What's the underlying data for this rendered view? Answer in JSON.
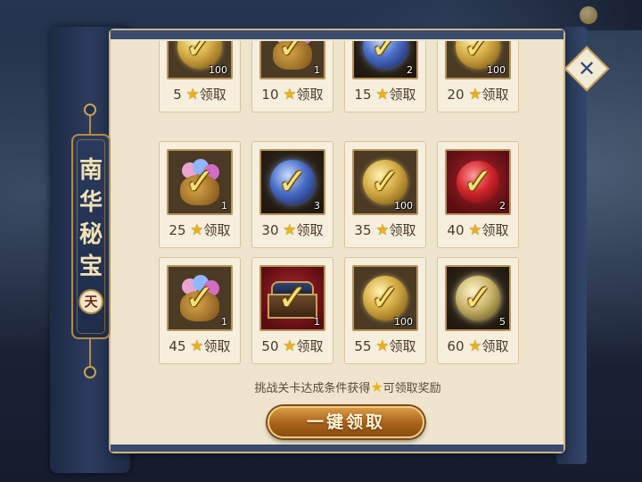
{
  "banner": {
    "title_chars": [
      "南",
      "华",
      "秘",
      "宝"
    ],
    "tier_badge": "天"
  },
  "rewards": [
    {
      "threshold": "5",
      "claim_label": "领取",
      "item": "gold-coin-icon",
      "qty": "100"
    },
    {
      "threshold": "10",
      "claim_label": "领取",
      "item": "treasure-bag-icon",
      "qty": "1"
    },
    {
      "threshold": "15",
      "claim_label": "领取",
      "item": "blue-orb-icon",
      "qty": "2"
    },
    {
      "threshold": "20",
      "claim_label": "领取",
      "item": "gold-coin-icon",
      "qty": "100"
    },
    {
      "threshold": "25",
      "claim_label": "领取",
      "item": "treasure-bag-icon",
      "qty": "1"
    },
    {
      "threshold": "30",
      "claim_label": "领取",
      "item": "blue-orb-icon",
      "qty": "3"
    },
    {
      "threshold": "35",
      "claim_label": "领取",
      "item": "gold-coin-icon",
      "qty": "100"
    },
    {
      "threshold": "40",
      "claim_label": "领取",
      "item": "red-orb-icon",
      "qty": "2"
    },
    {
      "threshold": "45",
      "claim_label": "领取",
      "item": "treasure-bag-icon",
      "qty": "1"
    },
    {
      "threshold": "50",
      "claim_label": "领取",
      "item": "treasure-chest-icon",
      "qty": "1"
    },
    {
      "threshold": "55",
      "claim_label": "领取",
      "item": "gold-coin-icon",
      "qty": "100"
    },
    {
      "threshold": "60",
      "claim_label": "领取",
      "item": "pale-orb-icon",
      "qty": "5"
    }
  ],
  "hint": {
    "before": "挑战关卡达成条件获得",
    "after": "可领取奖励"
  },
  "claim_all_label": "一键领取",
  "star_glyph": "★",
  "check_glyph": "✓",
  "close_glyph": "✕",
  "colors": {
    "accent_gold": "#c7a05a",
    "panel_bg": "#efe4cd",
    "star": "#e8b21b"
  }
}
